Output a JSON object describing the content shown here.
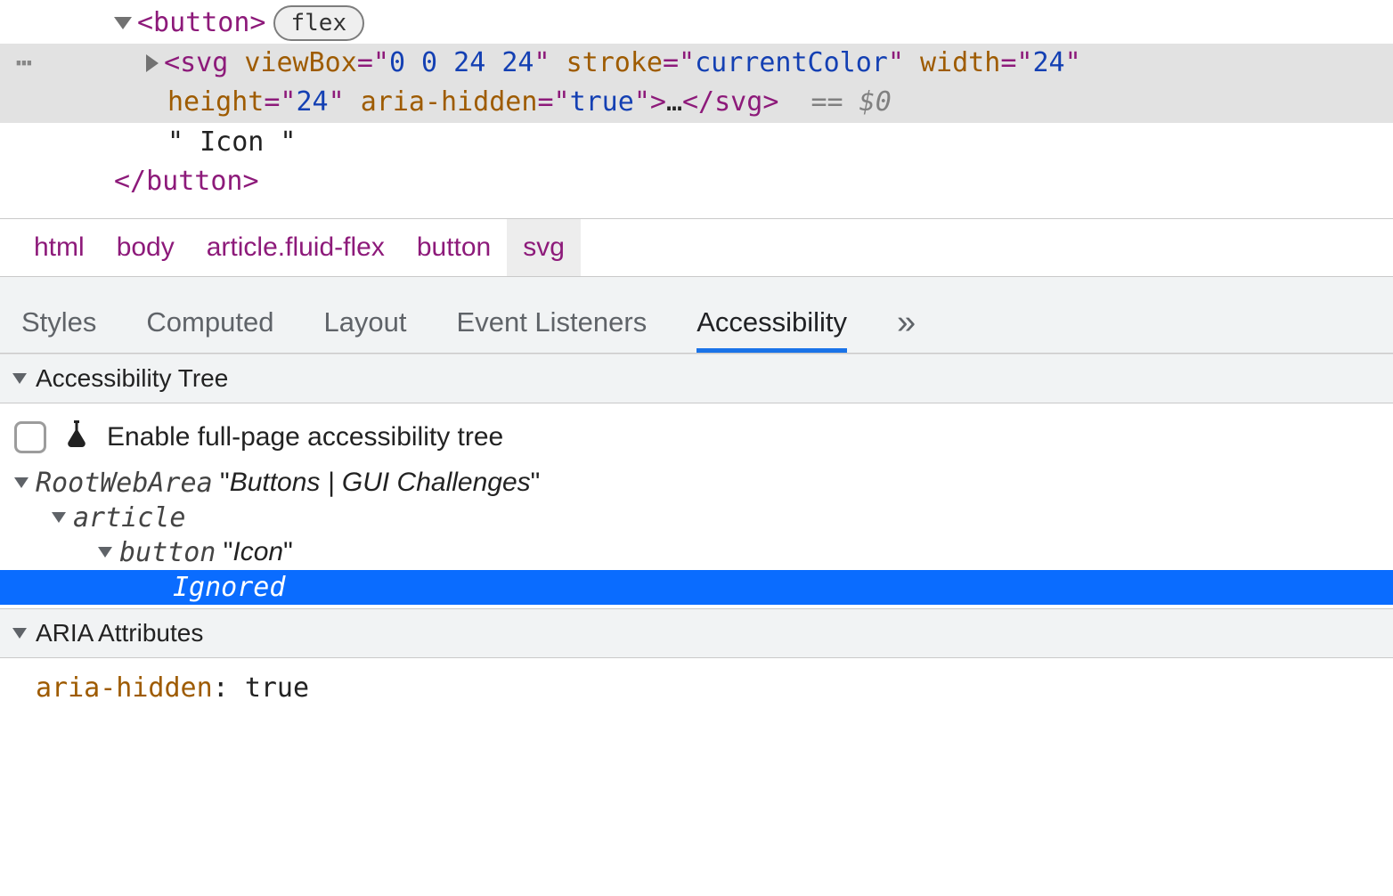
{
  "dom": {
    "button_open": "<button>",
    "button_close": "</button>",
    "flex_badge": "flex",
    "svg_tag": "svg",
    "svg_attrs": [
      {
        "name": "viewBox",
        "value": "0 0 24 24"
      },
      {
        "name": "stroke",
        "value": "currentColor"
      },
      {
        "name": "width",
        "value": "24"
      },
      {
        "name": "height",
        "value": "24"
      },
      {
        "name": "aria-hidden",
        "value": "true"
      }
    ],
    "svg_collapsed": "…",
    "eq_marker": "== $0",
    "text_node": "\" Icon \""
  },
  "breadcrumb": [
    "html",
    "body",
    "article.fluid-flex",
    "button",
    "svg"
  ],
  "tabs": {
    "items": [
      "Styles",
      "Computed",
      "Layout",
      "Event Listeners",
      "Accessibility"
    ],
    "active": "Accessibility",
    "overflow": "»"
  },
  "a11y": {
    "section_title": "Accessibility Tree",
    "enable_label": "Enable full-page accessibility tree",
    "tree": {
      "root_role": "RootWebArea",
      "root_name": "Buttons | GUI Challenges",
      "l2_role": "article",
      "l3_role": "button",
      "l3_name": "Icon",
      "ignored": "Ignored"
    }
  },
  "aria": {
    "section_title": "ARIA Attributes",
    "attr_name": "aria-hidden",
    "attr_value": "true"
  }
}
